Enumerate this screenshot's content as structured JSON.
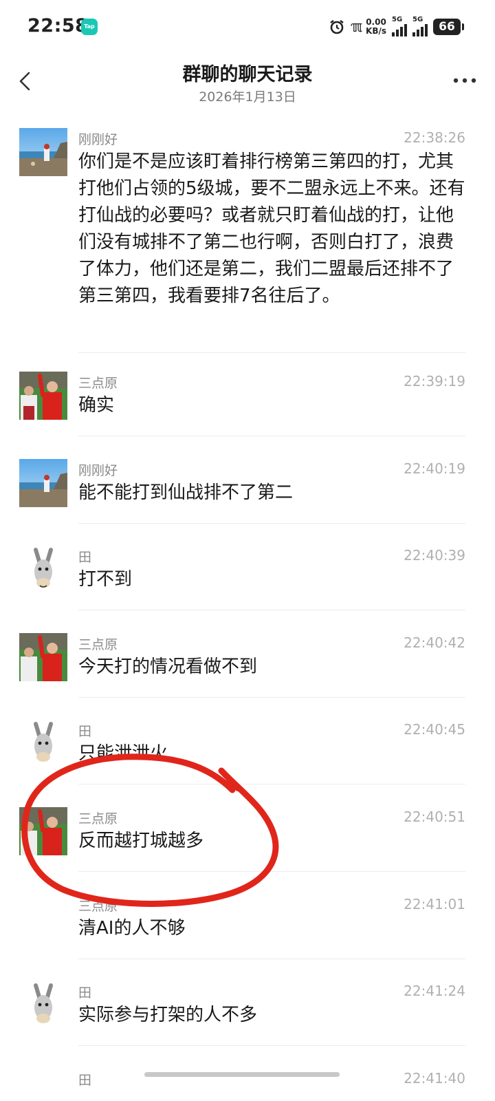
{
  "status_bar": {
    "time": "22:58",
    "tap_badge": "Tap",
    "nfc_label": "ℼ",
    "net_speed_value": "0.00",
    "net_speed_unit": "KB/s",
    "signal1_label": "5G",
    "signal2_label": "5G",
    "battery": "66"
  },
  "header": {
    "title": "群聊的聊天记录",
    "date": "2026年1月13日"
  },
  "messages": [
    {
      "sender": "刚刚好",
      "time": "22:38:26",
      "text": "你们是不是应该盯着排行榜第三第四的打，尤其打他们占领的5级城，要不二盟永远上不来。还有打仙战的必要吗？或者就只盯着仙战的打，让他们没有城排不了第二也行啊，否则白打了，浪费了体力，他们还是第二，我们二盟最后还排不了第三第四，我看要排7名往后了。"
    },
    {
      "sender": "三点原",
      "time": "22:39:19",
      "text": "确实"
    },
    {
      "sender": "刚刚好",
      "time": "22:40:19",
      "text": "能不能打到仙战排不了第二"
    },
    {
      "sender": "田",
      "time": "22:40:39",
      "text": "打不到"
    },
    {
      "sender": "三点原",
      "time": "22:40:42",
      "text": "今天打的情况看做不到"
    },
    {
      "sender": "田",
      "time": "22:40:45",
      "text": "只能泄泄火"
    },
    {
      "sender": "三点原",
      "time": "22:40:51",
      "text": "反而越打城越多"
    },
    {
      "sender": "三点原",
      "time": "22:41:01",
      "text": "清AI的人不够"
    },
    {
      "sender": "田",
      "time": "22:41:24",
      "text": "实际参与打架的人不多"
    },
    {
      "sender": "田",
      "time": "22:41:40",
      "text": ""
    }
  ],
  "colors": {
    "annotation_red": "#e0261b",
    "badge_teal": "#19c8b4"
  }
}
